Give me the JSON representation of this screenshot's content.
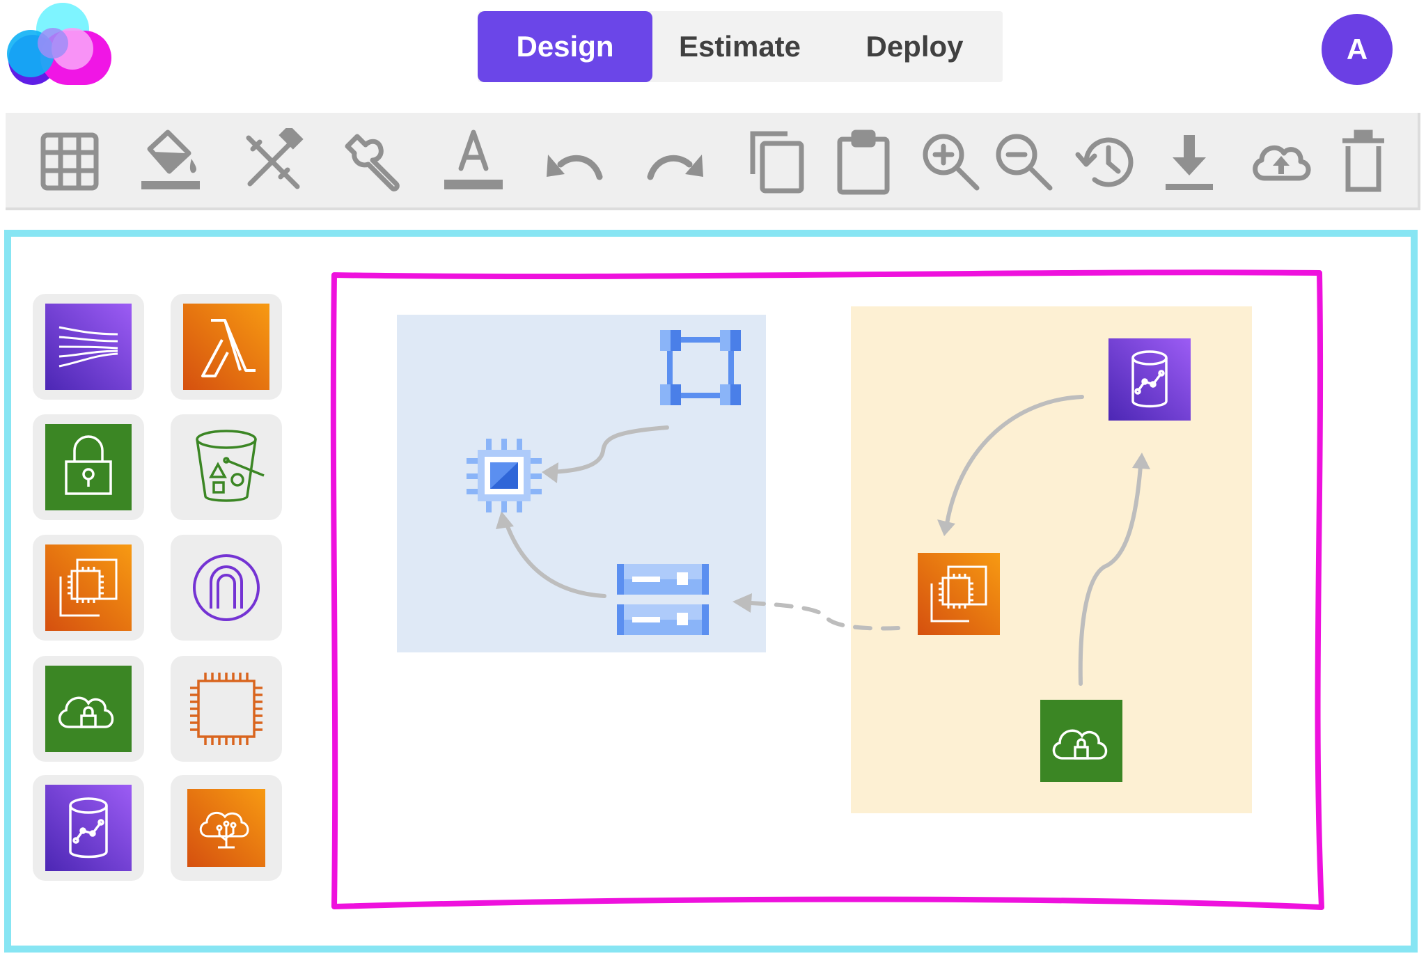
{
  "app": {
    "logo_icon": "cloud-logo-icon"
  },
  "tabs": [
    {
      "label": "Design",
      "active": true
    },
    {
      "label": "Estimate",
      "active": false
    },
    {
      "label": "Deploy",
      "active": false
    }
  ],
  "user": {
    "avatar_initial": "A"
  },
  "toolbar": {
    "tools": [
      "grid-icon",
      "paint-bucket-icon",
      "design-tools-icon",
      "wrench-icon",
      "text-color-icon",
      "undo-icon",
      "redo-icon",
      "copy-icon",
      "paste-icon",
      "zoom-in-icon",
      "zoom-out-icon",
      "history-icon",
      "download-icon",
      "cloud-upload-icon",
      "trash-icon"
    ]
  },
  "palette": {
    "items": [
      "kinesis-icon",
      "lambda-icon",
      "secrets-lock-icon",
      "s3-bucket-icon",
      "ec2-instances-icon",
      "api-gateway-icon",
      "vpn-cloud-lock-icon",
      "cpu-chip-icon",
      "timestream-database-icon",
      "cloud-tree-icon"
    ]
  },
  "colors": {
    "accent": "#6b46e8",
    "workspace_border": "#87e5f3",
    "canvas_border": "#ee11dd",
    "blue_group": "#dfe9f6",
    "yellow_group": "#fdf0d3",
    "aws_purple": "#6b3fe4",
    "aws_orange": "#e8711a",
    "aws_green": "#3b8624",
    "gcp_blue": "#5b8ff0",
    "connector": "#bdbdbd"
  },
  "diagram": {
    "nodes": [
      "gcp-cpu-icon",
      "gcp-network-icon",
      "gcp-storage-icon",
      "aws-database-icon",
      "aws-ec2-icon",
      "aws-vpn-cloud-icon"
    ]
  }
}
